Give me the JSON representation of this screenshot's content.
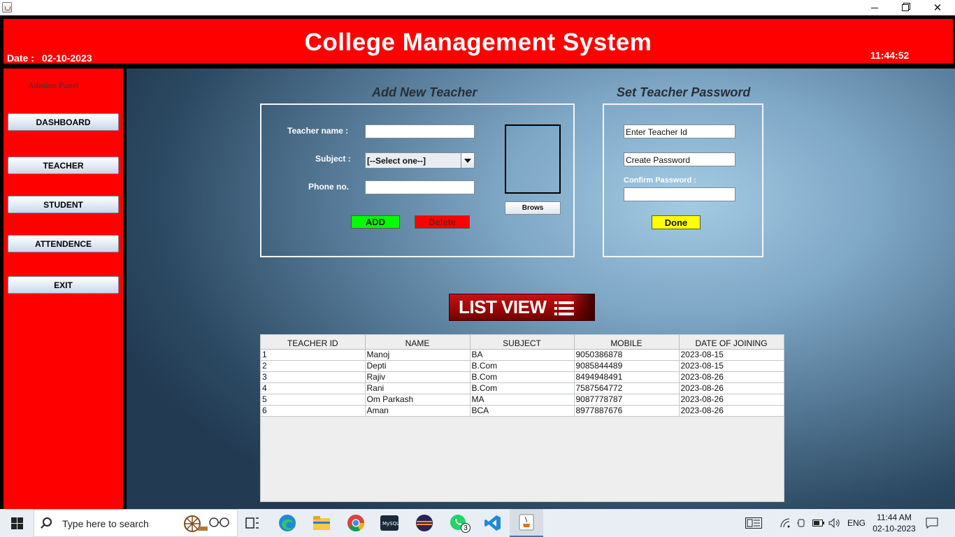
{
  "window": {
    "minimize": "—",
    "maximize": "▢",
    "close": "✕"
  },
  "header": {
    "title": "College Management System",
    "date_label": "Date :",
    "date_value": "02-10-2023",
    "time": "11:44:52"
  },
  "sidebar": {
    "panel_title": "Admine Panel",
    "buttons": [
      "DASHBOARD",
      "TEACHER",
      "STUDENT",
      "ATTENDENCE",
      "EXIT"
    ]
  },
  "add_teacher": {
    "title": "Add New Teacher",
    "name_label": "Teacher name :",
    "name_value": "",
    "subject_label": "Subject :",
    "subject_value": "[--Select one--]",
    "phone_label": "Phone no.",
    "phone_value": "",
    "browse": "Brows",
    "add": "ADD",
    "delete": "Delete"
  },
  "set_password": {
    "title": "Set Teacher Password",
    "teacher_id": "Enter Teacher Id",
    "create_password": "Create Password",
    "confirm_label": "Confirm Password :",
    "confirm_value": "",
    "done": "Done"
  },
  "list_view": {
    "label": "LIST VIEW"
  },
  "table": {
    "columns": [
      "TEACHER ID",
      "NAME",
      "SUBJECT",
      "MOBILE",
      "DATE OF JOINING"
    ],
    "rows": [
      [
        "1",
        "Manoj",
        "BA",
        "9050386878",
        "2023-08-15"
      ],
      [
        "2",
        "Depti",
        "B.Com",
        "9085844489",
        "2023-08-15"
      ],
      [
        "3",
        "Rajiv",
        "B.Com",
        "8494948491",
        "2023-08-26"
      ],
      [
        "4",
        "Rani",
        "B.Com",
        "7587564772",
        "2023-08-26"
      ],
      [
        "5",
        "Om Parkash",
        "MA",
        "9087778787",
        "2023-08-26"
      ],
      [
        "6",
        "Aman",
        "BCA",
        "8977887676",
        "2023-08-26"
      ]
    ]
  },
  "colors": {
    "header_red": "#ff0000",
    "add_green": "#00ff00",
    "delete_red": "#ff0000",
    "done_yellow": "#ffff00"
  },
  "taskbar": {
    "search_placeholder": "Type here to search",
    "whatsapp_badge": "3",
    "language": "ENG",
    "time": "11:44 AM",
    "date": "02-10-2023",
    "icons": [
      "start-icon",
      "task-view-icon",
      "edge-icon",
      "file-explorer-icon",
      "chrome-icon",
      "mysql-icon",
      "eclipse-icon",
      "whatsapp-icon",
      "vscode-icon",
      "java-icon"
    ]
  }
}
